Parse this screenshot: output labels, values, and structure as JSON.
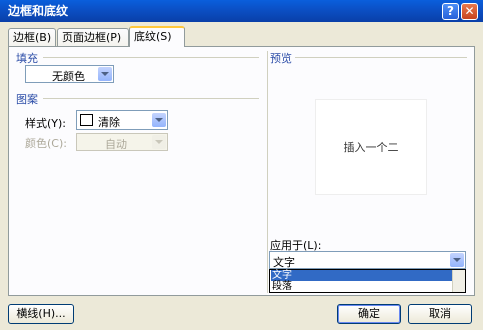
{
  "window": {
    "title": "边框和底纹",
    "help_label": "?",
    "close_label": "✕"
  },
  "tabs": [
    {
      "label": "边框(B)"
    },
    {
      "label": "页面边框(P)"
    },
    {
      "label": "底纹(S)"
    }
  ],
  "fill": {
    "group_label": "填充",
    "color_value": "无颜色"
  },
  "pattern": {
    "group_label": "图案",
    "style_label": "样式(Y):",
    "style_value": "清除",
    "color_label": "颜色(C):",
    "color_value": "自动"
  },
  "preview": {
    "group_label": "预览",
    "sample_text": "插入一个二"
  },
  "apply_to": {
    "label": "应用于(L):",
    "value": "文字",
    "options": [
      "文字",
      "段落"
    ],
    "selected_index": 0
  },
  "buttons": {
    "horizontal_line": "横线(H)...",
    "ok": "确定",
    "cancel": "取消"
  },
  "colors": {
    "titlebar": "#0b4fc4",
    "group_label": "#2d4ea8",
    "selection": "#316ac5",
    "active_tab_accent": "#ffc83c"
  }
}
